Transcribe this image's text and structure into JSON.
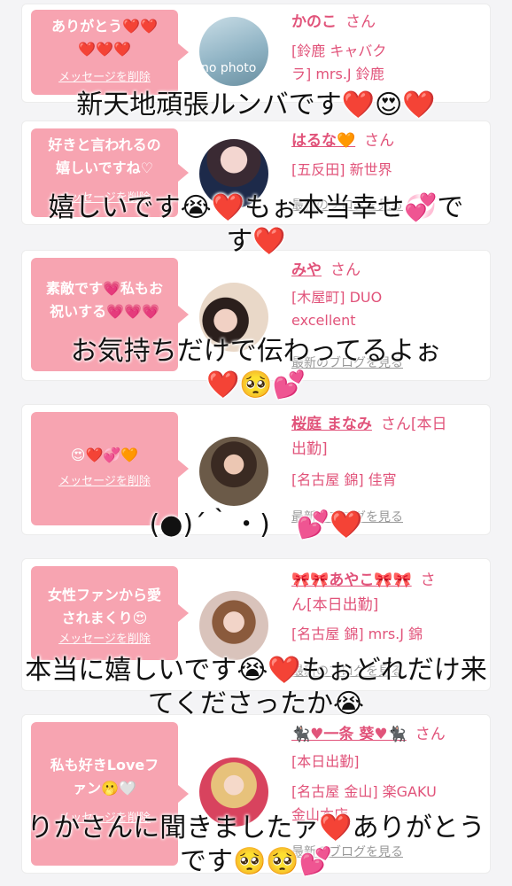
{
  "items": [
    {
      "message_line1": "ありがとう❤️❤️",
      "message_line2": "❤️❤️❤️",
      "delete_label": "メッセージを削除",
      "avatar_text": "no photo",
      "name": "かのこ",
      "san": "さん",
      "info_line1": "[鈴鹿 キャバク",
      "info_line2": "ラ] mrs.J 鈴鹿"
    },
    {
      "message_line1": "好きと言われるの",
      "message_line2": "嬉しいですね♡",
      "delete_label": "メッセージを削除",
      "name": "はるな🧡",
      "san": "さん",
      "info_line1": "[五反田] 新世界",
      "blog_label": "最新のブログを見る"
    },
    {
      "message_line1": "素敵です💗私もお",
      "message_line2": "祝いする💗💗💗",
      "name": "みや",
      "san": "さん",
      "info_line1": "[木屋町] DUO",
      "info_line2": "excellent",
      "blog_label": "最新のブログを見る"
    },
    {
      "message_line1": "😍❤️💞🧡",
      "delete_label": "メッセージを削除",
      "name": "桜庭 まなみ",
      "san": "さん[本日",
      "san_line2": "出勤]",
      "info_line1": "[名古屋 錦] 佳宵",
      "blog_label": "最新のブログを見る"
    },
    {
      "message_line1": "女性ファンから愛",
      "message_line2": "されまくり😍",
      "delete_label": "メッセージを削除",
      "name": "🎀🎀あやこ🎀🎀",
      "san": "さ",
      "san_line2": "ん[本日出勤]",
      "info_line1": "[名古屋 錦] mrs.J 錦",
      "blog_label": "最新のブログを見る"
    },
    {
      "message_line1": "私も好きLoveフ",
      "message_line2": "ァン🫢🤍",
      "delete_label": "メッセージを削除",
      "name": "🐈‍⬛♥一条 葵♥🐈‍⬛",
      "san": "さん",
      "info_line1": "[本日出勤]",
      "info_line2": "[名古屋 金山] 楽GAKU",
      "info_line3": "金山本店",
      "blog_label": "最新のブログを見る"
    }
  ],
  "overlays": [
    {
      "line1": "新天地頑張ルンバです❤️😍❤️"
    },
    {
      "line1": "嬉しいです😭❤️もぉ本当幸せ💞で",
      "line2": "す❤️"
    },
    {
      "line1": "お気持ちだけで伝わってるよぉ",
      "line2": "❤️🥺💕"
    },
    {
      "line1": "(●)´｀・)　💕❤️"
    },
    {
      "line1": "本当に嬉しいです😭❤️もぉどれだけ来",
      "line2": "てくださったか😭"
    },
    {
      "line1": "りかさんに聞きましたァ❤️ありがとう",
      "line2": "です🥺🥺💕"
    }
  ]
}
